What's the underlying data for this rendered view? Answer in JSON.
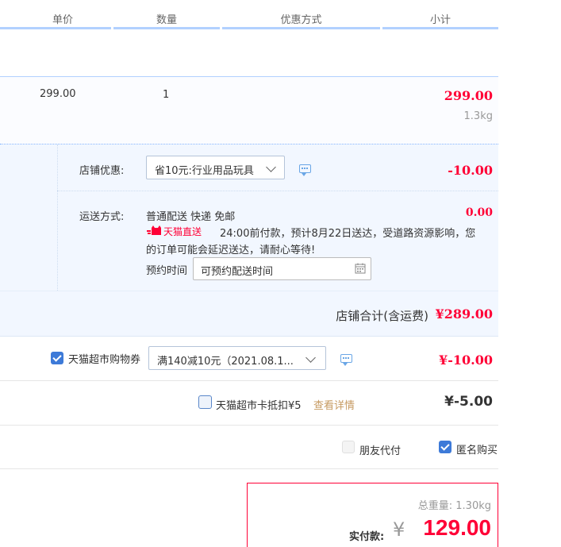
{
  "header": {
    "columns": [
      {
        "label": "单价"
      },
      {
        "label": "数量"
      },
      {
        "label": "优惠方式"
      },
      {
        "label": "小计"
      }
    ]
  },
  "item": {
    "unit_price": "299.00",
    "quantity": "1",
    "subtotal": "299.00",
    "weight": "1.3kg"
  },
  "shop_discount": {
    "label": "店铺优惠:",
    "selected": "省10元:行业用品玩具",
    "amount": "-10.00"
  },
  "shipping": {
    "label": "运送方式:",
    "method": "普通配送 快递 免邮",
    "amount": "0.00",
    "tmall_direct": "天猫直送",
    "notice_line1": "24:00前付款，预计8月22日送达，受道路资源影响，您",
    "notice_line2": "的订单可能会延迟送达，请耐心等待!",
    "schedule_label": "预约时间",
    "schedule_placeholder": "可预约配送时间"
  },
  "shop_total": {
    "label": "店铺合计(含运费)",
    "amount": "¥289.00"
  },
  "coupon": {
    "label": "天猫超市购物券",
    "checked": true,
    "selected": "满140减10元（2021.08.1...",
    "amount": "¥-10.00"
  },
  "card_deduction": {
    "label": "天猫超市卡抵扣¥5",
    "checked": false,
    "detail_link": "查看详情",
    "amount": "¥-5.00"
  },
  "options": {
    "friend_pay": {
      "label": "朋友代付",
      "checked": false
    },
    "anonymous": {
      "label": "匿名购买",
      "checked": true
    }
  },
  "summary": {
    "weight_label": "总重量:",
    "weight_value": "1.30kg",
    "pay_label": "实付款:",
    "currency": "¥",
    "pay_amount": "129.00"
  },
  "colors": {
    "accent_red": "#ff0036",
    "accent_blue": "#3d7ad8",
    "row_bg": "#f2f7ff",
    "header_bar": "#b2d1ff"
  }
}
